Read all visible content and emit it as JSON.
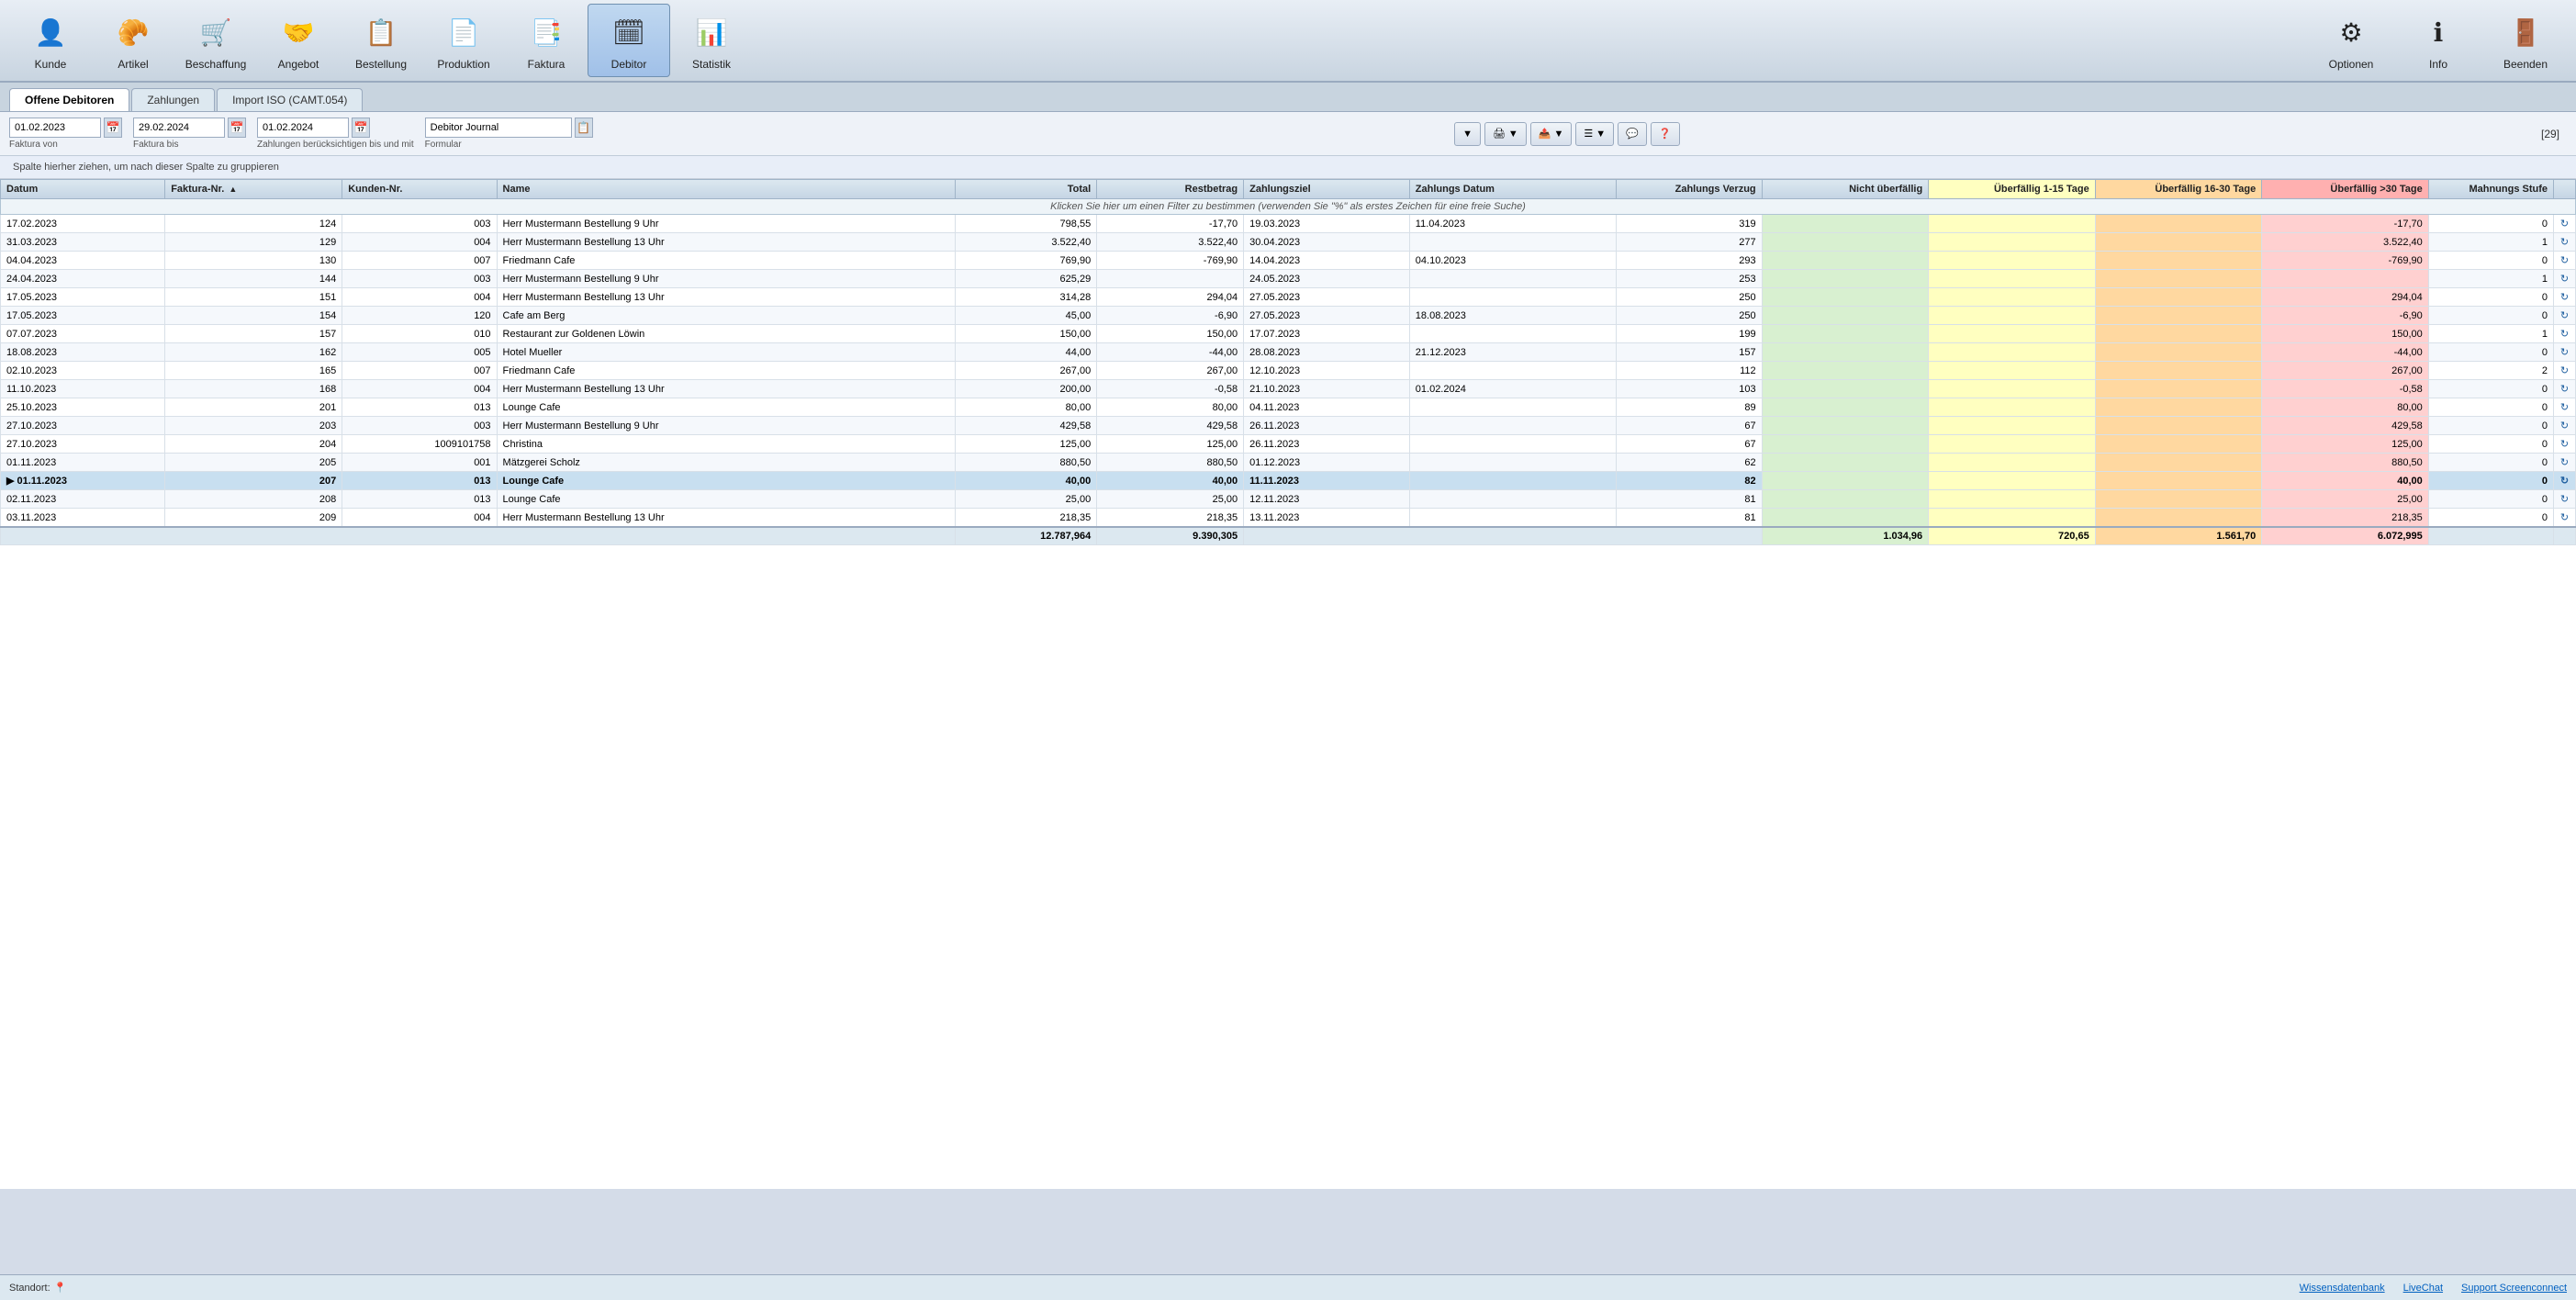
{
  "toolbar": {
    "items": [
      {
        "id": "kunde",
        "label": "Kunde",
        "icon": "👤"
      },
      {
        "id": "artikel",
        "label": "Artikel",
        "icon": "🥐"
      },
      {
        "id": "beschaffung",
        "label": "Beschaffung",
        "icon": "🛒"
      },
      {
        "id": "angebot",
        "label": "Angebot",
        "icon": "🤝"
      },
      {
        "id": "bestellung",
        "label": "Bestellung",
        "icon": "📋"
      },
      {
        "id": "produktion",
        "label": "Produktion",
        "icon": "📄"
      },
      {
        "id": "faktura",
        "label": "Faktura",
        "icon": "📑"
      },
      {
        "id": "debitor",
        "label": "Debitor",
        "icon": "🗓",
        "active": true
      },
      {
        "id": "statistik",
        "label": "Statistik",
        "icon": "📊"
      }
    ],
    "right_items": [
      {
        "id": "optionen",
        "label": "Optionen",
        "icon": "⚙"
      },
      {
        "id": "info",
        "label": "Info",
        "icon": "ℹ"
      },
      {
        "id": "beenden",
        "label": "Beenden",
        "icon": "🚪"
      }
    ]
  },
  "tabs": [
    {
      "id": "offene-debitoren",
      "label": "Offene Debitoren",
      "active": true
    },
    {
      "id": "zahlungen",
      "label": "Zahlungen"
    },
    {
      "id": "import-iso",
      "label": "Import ISO (CAMT.054)"
    }
  ],
  "filter": {
    "faktura_von_label": "Faktura von",
    "faktura_von": "01.02.2023",
    "faktura_bis_label": "Faktura bis",
    "faktura_bis": "29.02.2024",
    "zahlungen_label": "Zahlungen berücksichtigen bis und mit",
    "zahlungen_date": "01.02.2024",
    "formular_label": "Formular",
    "formular_value": "Debitor Journal",
    "count": "[29]"
  },
  "group_hint": "Spalte hierher ziehen, um nach dieser Spalte zu gruppieren",
  "filter_hint": "Klicken Sie hier um einen Filter zu bestimmen (verwenden Sie \"%\" als erstes Zeichen für eine freie Suche)",
  "columns": [
    {
      "id": "datum",
      "label": "Datum"
    },
    {
      "id": "faktura-nr",
      "label": "Faktura-Nr.",
      "sort": "asc"
    },
    {
      "id": "kunden-nr",
      "label": "Kunden-Nr."
    },
    {
      "id": "name",
      "label": "Name"
    },
    {
      "id": "total",
      "label": "Total",
      "align": "right"
    },
    {
      "id": "restbetrag",
      "label": "Restbetrag",
      "align": "right"
    },
    {
      "id": "zahlungsziel",
      "label": "Zahlungsziel"
    },
    {
      "id": "zahlungs-datum",
      "label": "Zahlungs Datum"
    },
    {
      "id": "zahlungs-verzug",
      "label": "Zahlungs Verzug",
      "align": "right"
    },
    {
      "id": "nicht-ueberfaellig",
      "label": "Nicht überfällig",
      "align": "right"
    },
    {
      "id": "ueberfaellig-1-15",
      "label": "Überfällig 1-15 Tage",
      "align": "right"
    },
    {
      "id": "ueberfaellig-16-30",
      "label": "Überfällig 16-30 Tage",
      "align": "right"
    },
    {
      "id": "ueberfaellig-30",
      "label": "Überfällig >30 Tage",
      "align": "right"
    },
    {
      "id": "mahnungs-stufe",
      "label": "Mahnungs Stufe",
      "align": "right"
    },
    {
      "id": "action",
      "label": ""
    }
  ],
  "rows": [
    {
      "datum": "17.02.2023",
      "faktura_nr": "124",
      "kunden_nr": "003",
      "name": "Herr Mustermann Bestellung 9 Uhr",
      "total": "798,55",
      "restbetrag": "-17,70",
      "zahlungsziel": "19.03.2023",
      "zahlungs_datum": "11.04.2023",
      "verzug": "319",
      "nicht": "",
      "ue1_15": "",
      "ue16_30": "",
      "ue30": "-17,70",
      "mahnung": "0",
      "row_class": ""
    },
    {
      "datum": "31.03.2023",
      "faktura_nr": "129",
      "kunden_nr": "004",
      "name": "Herr Mustermann Bestellung 13 Uhr",
      "total": "3.522,40",
      "restbetrag": "3.522,40",
      "zahlungsziel": "30.04.2023",
      "zahlungs_datum": "",
      "verzug": "277",
      "nicht": "",
      "ue1_15": "",
      "ue16_30": "",
      "ue30": "3.522,40",
      "mahnung": "1",
      "row_class": ""
    },
    {
      "datum": "04.04.2023",
      "faktura_nr": "130",
      "kunden_nr": "007",
      "name": "Friedmann Cafe",
      "total": "769,90",
      "restbetrag": "-769,90",
      "zahlungsziel": "14.04.2023",
      "zahlungs_datum": "04.10.2023",
      "verzug": "293",
      "nicht": "",
      "ue1_15": "",
      "ue16_30": "",
      "ue30": "-769,90",
      "mahnung": "0",
      "row_class": ""
    },
    {
      "datum": "24.04.2023",
      "faktura_nr": "144",
      "kunden_nr": "003",
      "name": "Herr Mustermann Bestellung 9 Uhr",
      "total": "625,29",
      "restbetrag": "",
      "zahlungsziel": "24.05.2023",
      "zahlungs_datum": "",
      "verzug": "253",
      "nicht": "",
      "ue1_15": "",
      "ue16_30": "",
      "ue30": "",
      "mahnung": "1",
      "row_class": ""
    },
    {
      "datum": "17.05.2023",
      "faktura_nr": "151",
      "kunden_nr": "004",
      "name": "Herr Mustermann Bestellung 13 Uhr",
      "total": "314,28",
      "restbetrag": "294,04",
      "zahlungsziel": "27.05.2023",
      "zahlungs_datum": "",
      "verzug": "250",
      "nicht": "",
      "ue1_15": "",
      "ue16_30": "",
      "ue30": "294,04",
      "mahnung": "0",
      "row_class": ""
    },
    {
      "datum": "17.05.2023",
      "faktura_nr": "154",
      "kunden_nr": "120",
      "name": "Cafe am Berg",
      "total": "45,00",
      "restbetrag": "-6,90",
      "zahlungsziel": "27.05.2023",
      "zahlungs_datum": "18.08.2023",
      "verzug": "250",
      "nicht": "",
      "ue1_15": "",
      "ue16_30": "",
      "ue30": "-6,90",
      "mahnung": "0",
      "row_class": ""
    },
    {
      "datum": "07.07.2023",
      "faktura_nr": "157",
      "kunden_nr": "010",
      "name": "Restaurant zur Goldenen Löwin",
      "total": "150,00",
      "restbetrag": "150,00",
      "zahlungsziel": "17.07.2023",
      "zahlungs_datum": "",
      "verzug": "199",
      "nicht": "",
      "ue1_15": "",
      "ue16_30": "",
      "ue30": "150,00",
      "mahnung": "1",
      "row_class": ""
    },
    {
      "datum": "18.08.2023",
      "faktura_nr": "162",
      "kunden_nr": "005",
      "name": "Hotel Mueller",
      "total": "44,00",
      "restbetrag": "-44,00",
      "zahlungsziel": "28.08.2023",
      "zahlungs_datum": "21.12.2023",
      "verzug": "157",
      "nicht": "",
      "ue1_15": "",
      "ue16_30": "",
      "ue30": "-44,00",
      "mahnung": "0",
      "row_class": ""
    },
    {
      "datum": "02.10.2023",
      "faktura_nr": "165",
      "kunden_nr": "007",
      "name": "Friedmann Cafe",
      "total": "267,00",
      "restbetrag": "267,00",
      "zahlungsziel": "12.10.2023",
      "zahlungs_datum": "",
      "verzug": "112",
      "nicht": "",
      "ue1_15": "",
      "ue16_30": "",
      "ue30": "267,00",
      "mahnung": "2",
      "row_class": ""
    },
    {
      "datum": "11.10.2023",
      "faktura_nr": "168",
      "kunden_nr": "004",
      "name": "Herr Mustermann Bestellung 13 Uhr",
      "total": "200,00",
      "restbetrag": "-0,58",
      "zahlungsziel": "21.10.2023",
      "zahlungs_datum": "01.02.2024",
      "verzug": "103",
      "nicht": "",
      "ue1_15": "",
      "ue16_30": "",
      "ue30": "-0,58",
      "mahnung": "0",
      "row_class": ""
    },
    {
      "datum": "25.10.2023",
      "faktura_nr": "201",
      "kunden_nr": "013",
      "name": "Lounge Cafe",
      "total": "80,00",
      "restbetrag": "80,00",
      "zahlungsziel": "04.11.2023",
      "zahlungs_datum": "",
      "verzug": "89",
      "nicht": "",
      "ue1_15": "",
      "ue16_30": "",
      "ue30": "80,00",
      "mahnung": "0",
      "row_class": ""
    },
    {
      "datum": "27.10.2023",
      "faktura_nr": "203",
      "kunden_nr": "003",
      "name": "Herr Mustermann Bestellung 9 Uhr",
      "total": "429,58",
      "restbetrag": "429,58",
      "zahlungsziel": "26.11.2023",
      "zahlungs_datum": "",
      "verzug": "67",
      "nicht": "",
      "ue1_15": "",
      "ue16_30": "",
      "ue30": "429,58",
      "mahnung": "0",
      "row_class": ""
    },
    {
      "datum": "27.10.2023",
      "faktura_nr": "204",
      "kunden_nr": "1009101758",
      "name": "Christina",
      "total": "125,00",
      "restbetrag": "125,00",
      "zahlungsziel": "26.11.2023",
      "zahlungs_datum": "",
      "verzug": "67",
      "nicht": "",
      "ue1_15": "",
      "ue16_30": "",
      "ue30": "125,00",
      "mahnung": "0",
      "row_class": ""
    },
    {
      "datum": "01.11.2023",
      "faktura_nr": "205",
      "kunden_nr": "001",
      "name": "Mätzgerei Scholz",
      "total": "880,50",
      "restbetrag": "880,50",
      "zahlungsziel": "01.12.2023",
      "zahlungs_datum": "",
      "verzug": "62",
      "nicht": "",
      "ue1_15": "",
      "ue16_30": "",
      "ue30": "880,50",
      "mahnung": "0",
      "row_class": ""
    },
    {
      "datum": "01.11.2023",
      "faktura_nr": "207",
      "kunden_nr": "013",
      "name": "Lounge Cafe",
      "total": "40,00",
      "restbetrag": "40,00",
      "zahlungsziel": "11.11.2023",
      "zahlungs_datum": "",
      "verzug": "82",
      "nicht": "",
      "ue1_15": "",
      "ue16_30": "",
      "ue30": "40,00",
      "mahnung": "0",
      "row_class": "active"
    },
    {
      "datum": "02.11.2023",
      "faktura_nr": "208",
      "kunden_nr": "013",
      "name": "Lounge Cafe",
      "total": "25,00",
      "restbetrag": "25,00",
      "zahlungsziel": "12.11.2023",
      "zahlungs_datum": "",
      "verzug": "81",
      "nicht": "",
      "ue1_15": "",
      "ue16_30": "",
      "ue30": "25,00",
      "mahnung": "0",
      "row_class": ""
    },
    {
      "datum": "03.11.2023",
      "faktura_nr": "209",
      "kunden_nr": "004",
      "name": "Herr Mustermann Bestellung 13 Uhr",
      "total": "218,35",
      "restbetrag": "218,35",
      "zahlungsziel": "13.11.2023",
      "zahlungs_datum": "",
      "verzug": "81",
      "nicht": "",
      "ue1_15": "",
      "ue16_30": "",
      "ue30": "218,35",
      "mahnung": "0",
      "row_class": ""
    }
  ],
  "totals": {
    "total": "12.787,964",
    "restbetrag": "9.390,305",
    "nicht": "1.034,96",
    "ue1_15": "720,65",
    "ue16_30": "1.561,70",
    "ue30": "6.072,995"
  },
  "status": {
    "standort_label": "Standort:",
    "links": [
      {
        "id": "wissensdatenbank",
        "label": "Wissensdatenbank"
      },
      {
        "id": "livechat",
        "label": "LiveChat"
      },
      {
        "id": "support-screenconnect",
        "label": "Support Screenconnect"
      }
    ]
  }
}
